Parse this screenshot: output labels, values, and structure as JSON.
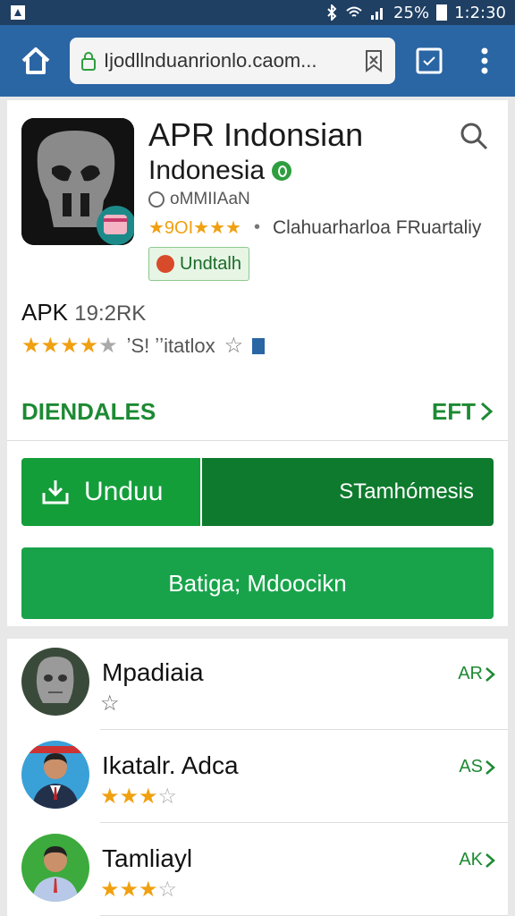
{
  "status_bar": {
    "battery_text": "25%",
    "time": "1:2:30"
  },
  "browser": {
    "url": "Ijodllnduanrionlo.caom...",
    "icons": [
      "home-icon",
      "lock-icon",
      "bookmark-icon",
      "tabs-icon",
      "overflow-menu-icon"
    ]
  },
  "app": {
    "title": "APR Indonsian",
    "developer": "Indonesia",
    "meta_text": "oMMIIAaN",
    "rating_text": "★9OI★★★",
    "category": "Clahuarharloa FRuartaliy",
    "install_badge": "Undtalh",
    "apk_title": "APK",
    "apk_size": "19:2RK",
    "apk_meta": "ʼS! ʼʼitatlox",
    "stars_filled": 4,
    "stars_total": 5
  },
  "section": {
    "label": "DIENDALES",
    "more_label": "EFT"
  },
  "buttons": {
    "download_label": "Unduu",
    "secondary_label": "STamhómesis",
    "full_label": "Batiga; Mdoocikn"
  },
  "list": [
    {
      "name": "Mpadiaia",
      "rating": 1,
      "action": "AR",
      "avatar": "mask-avatar"
    },
    {
      "name": "Ikatalr. Adca",
      "rating": 3,
      "action": "AS",
      "avatar": "man-suit-avatar"
    },
    {
      "name": "Tamliayl",
      "rating": 3,
      "action": "AK",
      "avatar": "man-shirt-avatar"
    }
  ],
  "colors": {
    "status_bar": "#1f3f63",
    "toolbar": "#2a65a4",
    "accent_green": "#139e3a",
    "dark_green": "#0e7a2d",
    "star": "#f0a010"
  }
}
